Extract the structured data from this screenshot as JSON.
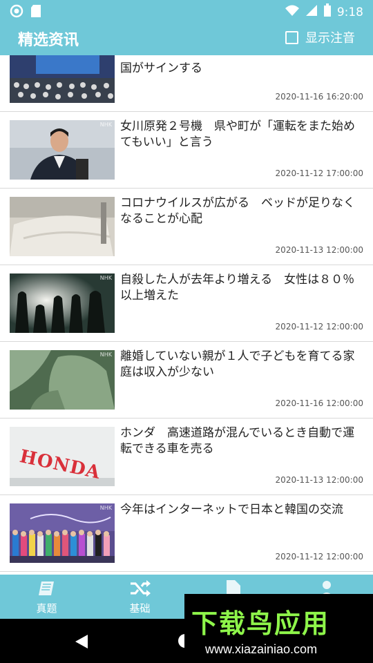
{
  "status_bar": {
    "time": "9:18"
  },
  "app_bar": {
    "title": "精选资讯",
    "show_ruby_label": "显示注音",
    "show_ruby_checked": false
  },
  "news": [
    {
      "title": "国がサインする",
      "date": "2020-11-16 16:20:00"
    },
    {
      "title": "女川原発２号機　県や町が「運転をまた始めてもいい」と言う",
      "date": "2020-11-12 17:00:00"
    },
    {
      "title": "コロナウイルスが広がる　ベッドが足りなくなることが心配",
      "date": "2020-11-13 12:00:00"
    },
    {
      "title": "自殺した人が去年より増える　女性は８０％以上増えた",
      "date": "2020-11-12 12:00:00"
    },
    {
      "title": "離婚していない親が１人で子どもを育てる家庭は収入が少ない",
      "date": "2020-11-16 12:00:00"
    },
    {
      "title": "ホンダ　高速道路が混んでいるとき自動で運転できる車を売る",
      "date": "2020-11-13 12:00:00"
    },
    {
      "title": "今年はインターネットで日本と韓国の交流",
      "date": "2020-11-12 12:00:00"
    }
  ],
  "thumb_text": {
    "honda": "HONDA",
    "nhk": "NHK"
  },
  "bottom_nav": [
    {
      "label": "真题",
      "icon": "book-icon"
    },
    {
      "label": "基础",
      "icon": "shuffle-icon"
    },
    {
      "label": "",
      "icon": "document-icon"
    },
    {
      "label": "",
      "icon": "person-icon"
    }
  ],
  "watermark": {
    "logo": "下载鸟应用",
    "url": "www.xiazainiao.com"
  },
  "colors": {
    "primary": "#6fc8d8",
    "watermark_green": "#8ef54a"
  }
}
